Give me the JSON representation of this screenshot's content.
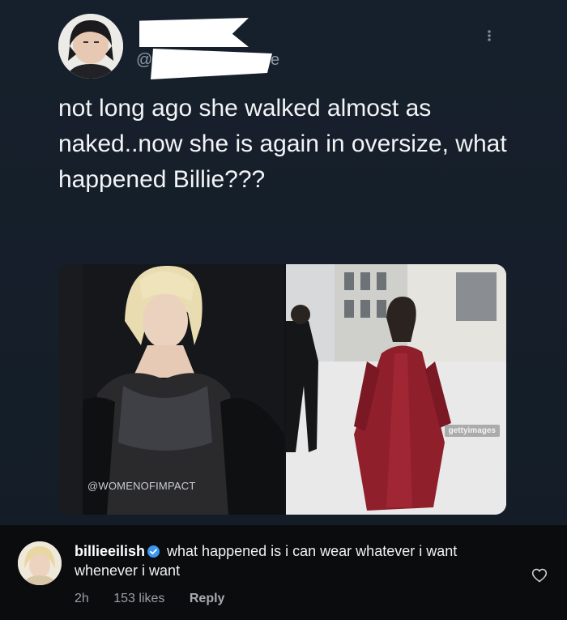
{
  "tweet": {
    "handle_prefix": "@",
    "handle_suffix": "e",
    "menu_icon": "more-vertical-icon",
    "text": "not long ago she walked almost as naked..now she is again in oversize, what happened Billie???",
    "media": {
      "watermark": "@WOMENOFIMPACT",
      "getty_label": "gettyimages"
    }
  },
  "comment": {
    "username": "billieeilish",
    "verified_icon": "verified-badge-icon",
    "text": "what happened is i can wear whatever i want whenever i want",
    "time": "2h",
    "likes": "153 likes",
    "reply_label": "Reply",
    "like_icon": "heart-icon"
  },
  "colors": {
    "tweet_bg": "#15202b",
    "tweet_text": "#f2f4f6",
    "comment_bg": "#0b0c0e",
    "verified": "#3b97f0",
    "coat_red": "#8e1f2b"
  }
}
